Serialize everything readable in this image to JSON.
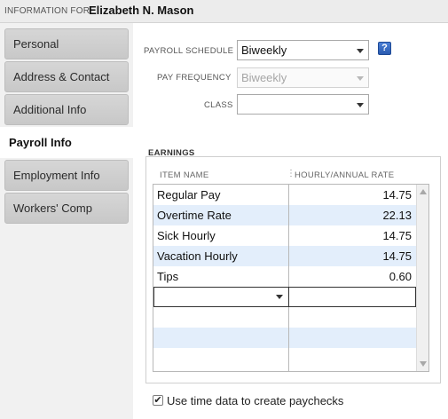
{
  "header": {
    "info_for_label": "INFORMATION FOR",
    "employee_name": "Elizabeth N. Mason"
  },
  "sidebar": {
    "tabs": [
      {
        "label": "Personal"
      },
      {
        "label": "Address & Contact"
      },
      {
        "label": "Additional Info"
      },
      {
        "label": "Payroll Info"
      },
      {
        "label": "Employment Info"
      },
      {
        "label": "Workers' Comp"
      }
    ],
    "active_tab": "Payroll Info"
  },
  "form": {
    "payroll_schedule_label": "PAYROLL SCHEDULE",
    "payroll_schedule_value": "Biweekly",
    "help_label": "?",
    "pay_frequency_label": "PAY FREQUENCY",
    "pay_frequency_value": "Biweekly",
    "class_label": "CLASS",
    "class_value": ""
  },
  "earnings": {
    "section_label": "EARNINGS",
    "col_item_name": "ITEM NAME",
    "col_rate": "HOURLY/ANNUAL RATE",
    "col_sep": "⋮",
    "rows": [
      {
        "name": "Regular Pay",
        "rate": "14.75"
      },
      {
        "name": "Overtime Rate",
        "rate": "22.13"
      },
      {
        "name": "Sick Hourly",
        "rate": "14.75"
      },
      {
        "name": "Vacation Hourly",
        "rate": "14.75"
      },
      {
        "name": "Tips",
        "rate": "0.60"
      }
    ]
  },
  "options": {
    "use_time_data_checked": true,
    "use_time_data_label": "Use time data to create paychecks",
    "check_mark": "✔"
  },
  "colors": {
    "alt_row": "#e3eefb",
    "help_button": "#2a5bb0",
    "sidebar_bg": "#f1f1f1"
  }
}
